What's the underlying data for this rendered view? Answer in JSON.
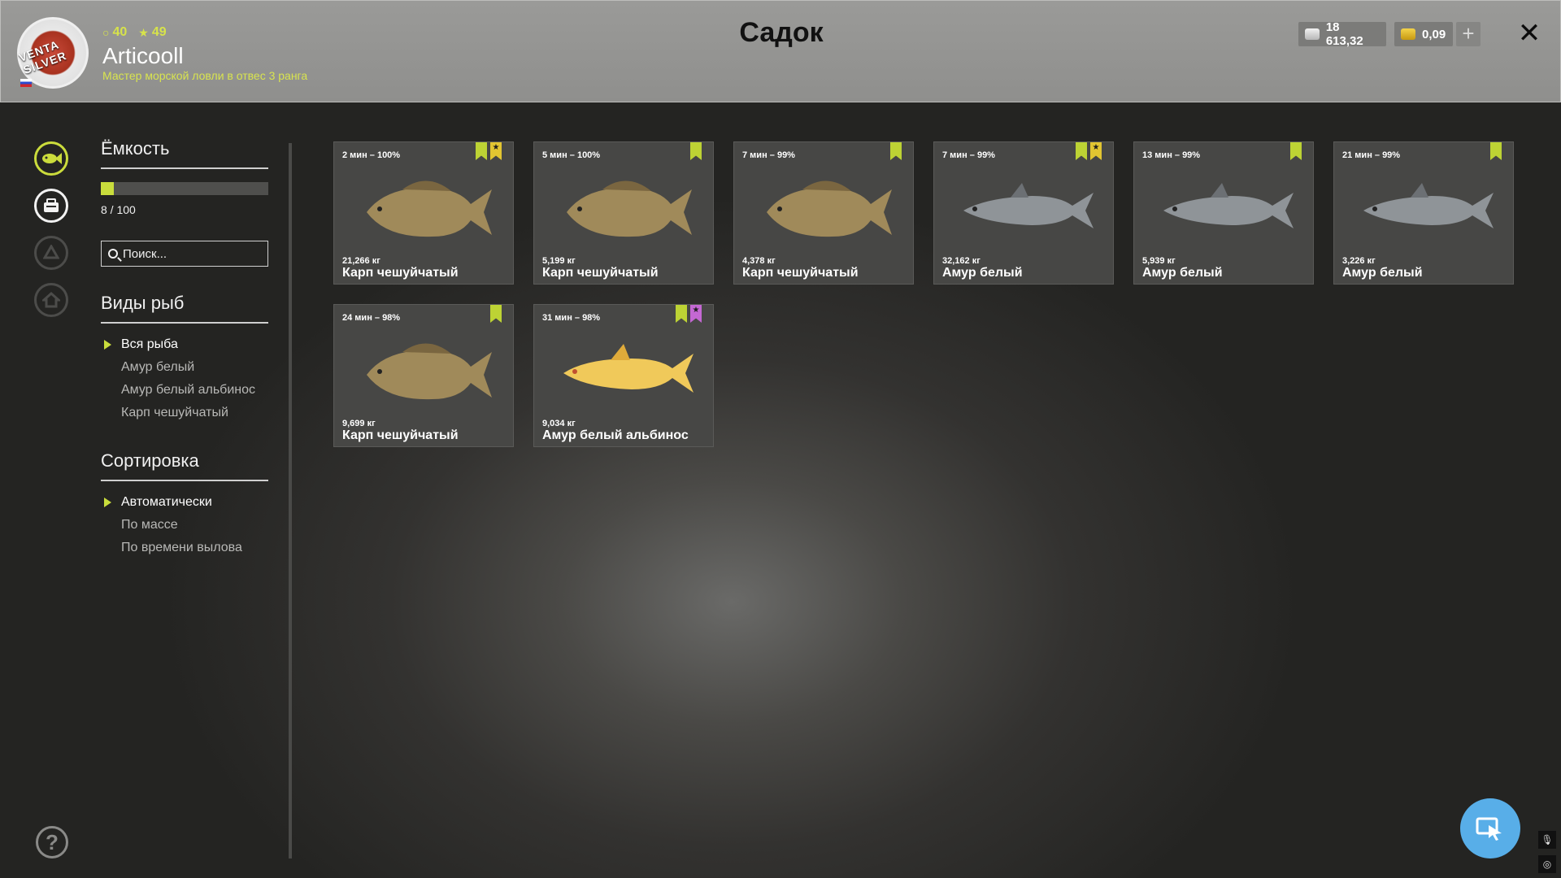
{
  "header": {
    "title": "Садок",
    "level": "40",
    "stars": "49",
    "username": "Articooll",
    "rank": "Мастер морской ловли в отвес 3 ранга",
    "avatar_text": "VENTA SILVER",
    "silver": "18 613,32",
    "gold": "0,09",
    "plus": "+",
    "close": "✕"
  },
  "sidebar": {
    "capacity_title": "Ёмкость",
    "capacity_text": "8 / 100",
    "capacity_fraction": 0.08,
    "search_placeholder": "Поиск...",
    "species_title": "Виды рыб",
    "species": [
      "Вся рыба",
      "Амур белый",
      "Амур белый альбинос",
      "Карп чешуйчатый"
    ],
    "sort_title": "Сортировка",
    "sort": [
      "Автоматически",
      "По массе",
      "По времени вылова"
    ],
    "help": "?"
  },
  "fish": [
    {
      "time": "2 мин – 100%",
      "weight": "21,266 кг",
      "name": "Карп чешуйчатый"
    },
    {
      "time": "5 мин – 100%",
      "weight": "5,199 кг",
      "name": "Карп чешуйчатый"
    },
    {
      "time": "7 мин – 99%",
      "weight": "4,378 кг",
      "name": "Карп чешуйчатый"
    },
    {
      "time": "7 мин – 99%",
      "weight": "32,162 кг",
      "name": "Амур белый"
    },
    {
      "time": "13 мин – 99%",
      "weight": "5,939 кг",
      "name": "Амур белый"
    },
    {
      "time": "21 мин – 99%",
      "weight": "3,226 кг",
      "name": "Амур белый"
    },
    {
      "time": "24 мин – 98%",
      "weight": "9,699 кг",
      "name": "Карп чешуйчатый"
    },
    {
      "time": "31 мин – 98%",
      "weight": "9,034 кг",
      "name": "Амур белый альбинос"
    }
  ],
  "colors": {
    "accent": "#c9dd3c",
    "header_bg": "#9a9a98",
    "card_bg": "#474745",
    "carp": "#a08a5a",
    "amur": "#8f9498",
    "albino": "#f0c95a"
  }
}
